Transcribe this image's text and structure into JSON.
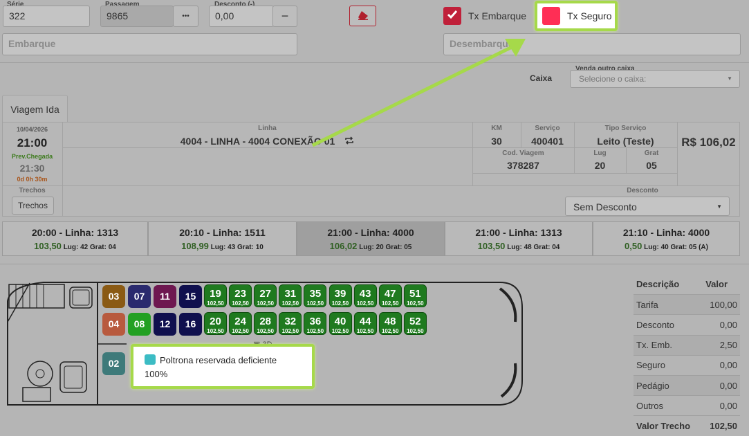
{
  "form": {
    "serie_label": "Série",
    "serie_value": "322",
    "passagem_label": "Passagem",
    "passagem_value": "9865",
    "dots": "•••",
    "desconto_label": "Desconto (-)",
    "desconto_value": "0,00",
    "minus": "−",
    "tx_embarque_label": "Tx Embarque",
    "tx_seguro_label": "Tx Seguro",
    "embarque_placeholder": "Embarque",
    "desembarque_placeholder": "Desembarque",
    "caixa_label": "Caixa",
    "venda_outro_caixa_label": "Venda outro caixa",
    "caixa_select": "Selecione o caixa:"
  },
  "tabs": [
    "Viagem Ida"
  ],
  "trip": {
    "date": "10/04/2026",
    "time": "21:00",
    "prev_label": "Prev.Chegada",
    "prev_time": "21:30",
    "duration": "0d 0h 30m",
    "linha_caption": "Linha",
    "linha_value": "4004 - LINHA - 4004 CONEXÃO 01",
    "km_caption": "KM",
    "km_value": "30",
    "servico_caption": "Serviço",
    "servico_value": "400401",
    "tipo_caption": "Tipo Serviço",
    "tipo_value": "Leito (Teste)",
    "price": "R$ 106,02",
    "cod_caption": "Cod. Viagem",
    "cod_value": "378287",
    "lug_caption": "Lug",
    "lug_value": "20",
    "grat_caption": "Grat",
    "grat_value": "05",
    "trechos_caption": "Trechos",
    "trechos_button": "Trechos",
    "desconto_caption": "Desconto",
    "desconto_select": "Sem Desconto"
  },
  "trips": [
    {
      "title": "20:00 - Linha: 1313",
      "price": "103,50",
      "lug_label": "Lug:",
      "lug": "42",
      "grat_label": "Grat:",
      "grat": "04",
      "extra": ""
    },
    {
      "title": "20:10 - Linha: 1511",
      "price": "108,99",
      "lug_label": "Lug:",
      "lug": "43",
      "grat_label": "Grat:",
      "grat": "10",
      "extra": ""
    },
    {
      "title": "21:00 - Linha: 4000",
      "price": "106,02",
      "lug_label": "Lug:",
      "lug": "20",
      "grat_label": "Grat:",
      "grat": "05",
      "extra": ""
    },
    {
      "title": "21:00 - Linha: 1313",
      "price": "103,50",
      "lug_label": "Lug:",
      "lug": "48",
      "grat_label": "Grat:",
      "grat": "04",
      "extra": ""
    },
    {
      "title": "21:10 - Linha: 4000",
      "price": "0,50",
      "lug_label": "Lug:",
      "lug": "40",
      "grat_label": "Grat:",
      "grat": "05",
      "extra": "(A)"
    }
  ],
  "seats": {
    "special_top": [
      "03",
      "07",
      "11",
      "15"
    ],
    "special_bottom": [
      "04",
      "08",
      "12",
      "16"
    ],
    "special_front": "02",
    "special_colors": {
      "03": "#8a5a14",
      "07": "#2a2a6e",
      "11": "#6e1850",
      "15": "#10104e",
      "04": "#b85a3e",
      "08": "#23a023",
      "12": "#10104e",
      "16": "#10104e",
      "02": "#3e7a7a"
    },
    "top_row": [
      {
        "n": "19",
        "p": "102,50"
      },
      {
        "n": "23",
        "p": "102,50"
      },
      {
        "n": "27",
        "p": "102,50"
      },
      {
        "n": "31",
        "p": "102,50"
      },
      {
        "n": "35",
        "p": "102,50"
      },
      {
        "n": "39",
        "p": "102,50"
      },
      {
        "n": "43",
        "p": "102,50"
      },
      {
        "n": "47",
        "p": "102,50"
      },
      {
        "n": "51",
        "p": "102,50"
      }
    ],
    "bottom_row": [
      {
        "n": "20",
        "p": "102,50"
      },
      {
        "n": "24",
        "p": "102,50"
      },
      {
        "n": "28",
        "p": "102,50"
      },
      {
        "n": "32",
        "p": "102,50"
      },
      {
        "n": "36",
        "p": "102,50"
      },
      {
        "n": "40",
        "p": "102,50"
      },
      {
        "n": "44",
        "p": "102,50"
      },
      {
        "n": "48",
        "p": "102,50"
      },
      {
        "n": "52",
        "p": "102,50"
      }
    ],
    "view_3d": "3D"
  },
  "tooltip": {
    "text": "Poltrona reservada deficiente",
    "percent": "100%"
  },
  "summary": {
    "head_desc": "Descrição",
    "head_val": "Valor",
    "rows": [
      {
        "label": "Tarifa",
        "value": "100,00"
      },
      {
        "label": "Desconto",
        "value": "0,00"
      },
      {
        "label": "Tx. Emb.",
        "value": "2,50"
      },
      {
        "label": "Seguro",
        "value": "0,00"
      },
      {
        "label": "Pedágio",
        "value": "0,00"
      },
      {
        "label": "Outros",
        "value": "0,00"
      }
    ],
    "total_label": "Valor Trecho",
    "total_value": "102,50"
  },
  "colors": {
    "highlight": "#a6d94a",
    "seat_green": "#1f7a1f",
    "checkbox_red": "#c0203a"
  }
}
